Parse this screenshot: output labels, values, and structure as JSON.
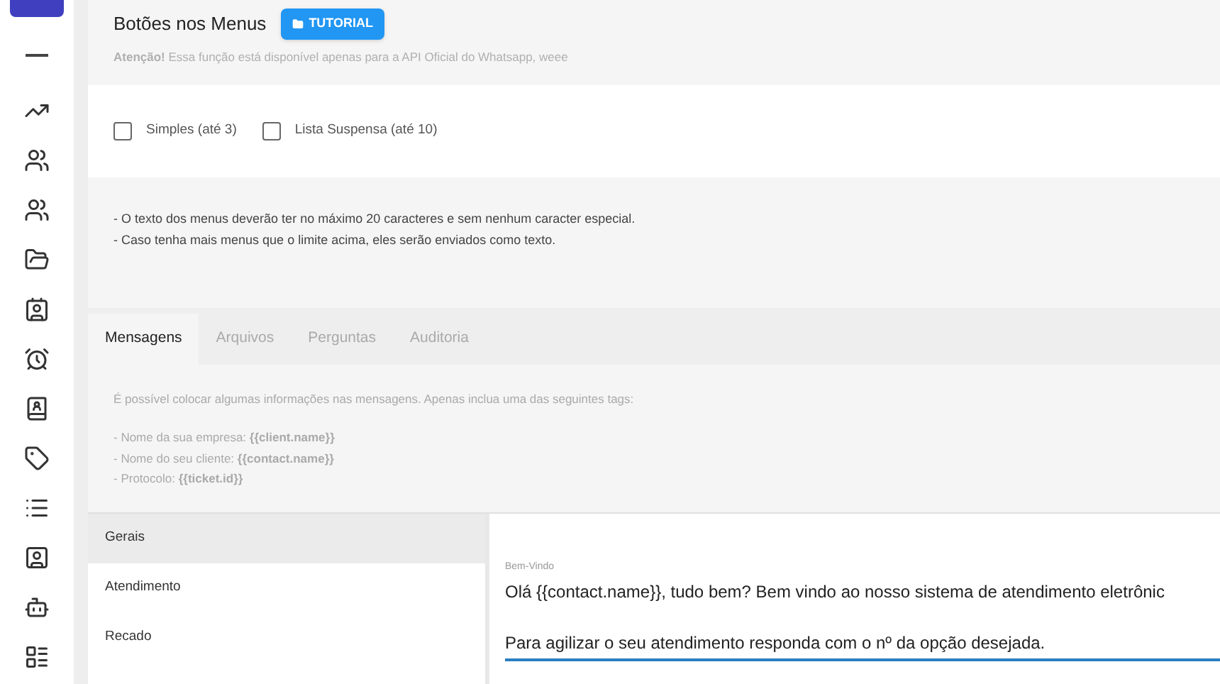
{
  "header": {
    "title": "Botões nos Menus",
    "tutorial_button": "TUTORIAL",
    "notice": "**Atenção!** Essa função está disponível apenas para a API Oficial do Whatsapp, weee"
  },
  "options": [
    {
      "label": "Simples (até 3)",
      "checked": false
    },
    {
      "label": "Lista Suspensa (até 10)",
      "checked": false
    }
  ],
  "rules": [
    "- O texto dos menus deverão ter no máximo 20 caracteres e sem nenhum caracter especial.",
    "- Caso tenha mais menus que o limite acima, eles serão enviados como texto."
  ],
  "tabs": [
    {
      "label": "Mensagens",
      "selected": true
    },
    {
      "label": "Arquivos",
      "selected": false
    },
    {
      "label": "Perguntas",
      "selected": false
    },
    {
      "label": "Auditoria",
      "selected": false
    }
  ],
  "info": {
    "intro": "É possível colocar algumas informações nas mensagens. Apenas inclua uma das seguintes tags:",
    "tags": [
      "- Nome da sua empresa: **{{client.name}}**",
      "- Nome do seu cliente: **{{contact.name}}**",
      "- Protocolo: **{{ticket.id}}**"
    ]
  },
  "message_types": [
    {
      "label": "Gerais",
      "selected": true
    },
    {
      "label": "Atendimento",
      "selected": false
    },
    {
      "label": "Recado",
      "selected": false
    }
  ],
  "field": {
    "label": "Bem-Vindo",
    "lines": [
      "Olá {{contact.name}}, tudo bem? Bem vindo ao nosso sistema de atendimento eletrônic",
      "Para agilizar o seu atendimento responda com o nº da opção desejada."
    ]
  }
}
